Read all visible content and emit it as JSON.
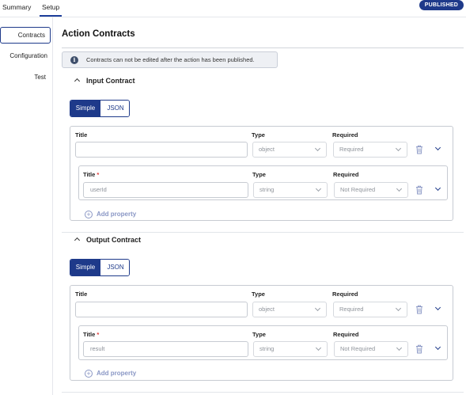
{
  "header": {
    "tabs": [
      {
        "label": "Summary"
      },
      {
        "label": "Setup"
      }
    ],
    "status_badge": "PUBLISHED"
  },
  "sidebar": {
    "items": [
      {
        "label": "Contracts",
        "active": true
      },
      {
        "label": "Configuration"
      },
      {
        "label": "Test"
      }
    ]
  },
  "main": {
    "title": "Action Contracts",
    "info_message": "Contracts can not be edited after the action has been published.",
    "info_icon": "info-icon",
    "input_contract": {
      "heading": "Input Contract",
      "toggle": {
        "simple": "Simple",
        "json": "JSON",
        "selected": "Simple"
      },
      "root": {
        "title_label": "Title",
        "type_label": "Type",
        "required_label": "Required",
        "title_value": "",
        "type_value": "object",
        "required_value": "Required"
      },
      "properties": [
        {
          "title_label": "Title",
          "required_marker": "*",
          "type_label": "Type",
          "required_label": "Required",
          "title_value": "userId",
          "type_value": "string",
          "required_value": "Not Required"
        }
      ],
      "add_property": "Add property"
    },
    "output_contract": {
      "heading": "Output Contract",
      "toggle": {
        "simple": "Simple",
        "json": "JSON",
        "selected": "Simple"
      },
      "root": {
        "title_label": "Title",
        "type_label": "Type",
        "required_label": "Required",
        "title_value": "",
        "type_value": "object",
        "required_value": "Required"
      },
      "properties": [
        {
          "title_label": "Title",
          "required_marker": "*",
          "type_label": "Type",
          "required_label": "Required",
          "title_value": "result",
          "type_value": "string",
          "required_value": "Not Required"
        }
      ],
      "add_property": "Add property"
    }
  },
  "colors": {
    "accent": "#1e3a8a",
    "badge_bg": "#1e3a8a",
    "add_property": "#8a97c5",
    "required_star": "#dd3333"
  }
}
